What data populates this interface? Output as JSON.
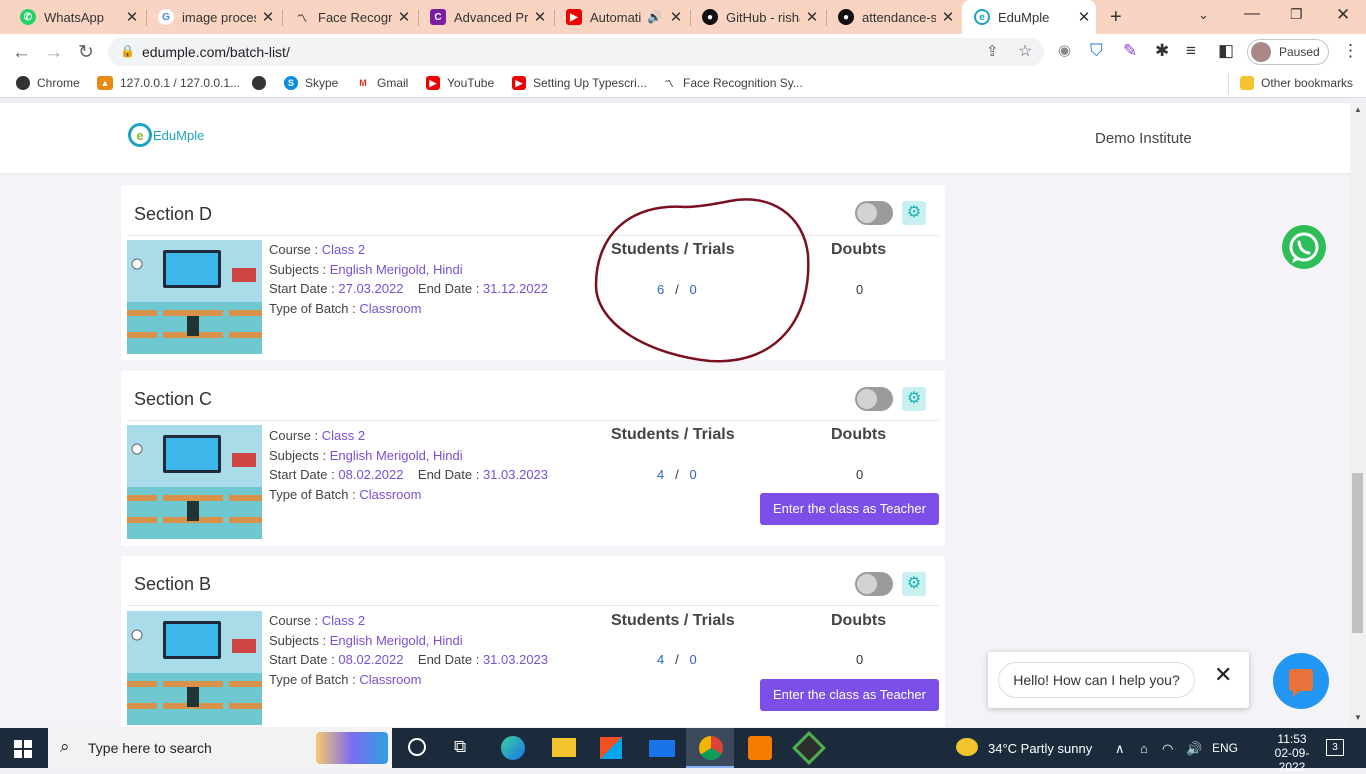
{
  "tabs": [
    {
      "title": "WhatsApp",
      "icon": "whatsapp-icon"
    },
    {
      "title": "image process",
      "icon": "google-icon"
    },
    {
      "title": "Face Recogniti",
      "icon": "chart-icon"
    },
    {
      "title": "Advanced Pro",
      "icon": "cs-icon"
    },
    {
      "title": "Automati",
      "icon": "youtube-icon"
    },
    {
      "title": "GitHub - risha",
      "icon": "github-icon"
    },
    {
      "title": "attendance-sy",
      "icon": "github-icon"
    },
    {
      "title": "EduMple",
      "icon": "edumple-icon"
    }
  ],
  "browser": {
    "url": "edumple.com/batch-list/",
    "profile": "Paused"
  },
  "bookmarks": [
    {
      "label": "Chrome",
      "icon": "chrome-icon"
    },
    {
      "label": "127.0.0.1 / 127.0.0.1...",
      "icon": "pma-icon"
    },
    {
      "label": "",
      "icon": "globe-icon"
    },
    {
      "label": "Skype",
      "icon": "skype-icon"
    },
    {
      "label": "Gmail",
      "icon": "gmail-icon"
    },
    {
      "label": "YouTube",
      "icon": "youtube-icon"
    },
    {
      "label": "Setting Up Typescri...",
      "icon": "youtube-icon"
    },
    {
      "label": "Face Recognition Sy...",
      "icon": "chart-icon"
    }
  ],
  "other_bookmarks": "Other bookmarks",
  "site": {
    "logo": "EduMple",
    "institute": "Demo Institute"
  },
  "labels": {
    "course": "Course : ",
    "subjects": "Subjects : ",
    "start": "Start Date : ",
    "end": "End Date : ",
    "type": "Type of Batch : ",
    "students_trials": "Students / Trials",
    "doubts": "Doubts",
    "slash": "/",
    "teacher_button": "Enter the class as Teacher"
  },
  "batches": [
    {
      "name": "Section D",
      "course": "Class 2",
      "subjects": "English Merigold, Hindi",
      "start": "27.03.2022",
      "end": "31.12.2022",
      "type": "Classroom",
      "students": "6",
      "trials": "0",
      "doubts": "0"
    },
    {
      "name": "Section C",
      "course": "Class 2",
      "subjects": "English Merigold, Hindi",
      "start": "08.02.2022",
      "end": "31.03.2023",
      "type": "Classroom",
      "students": "4",
      "trials": "0",
      "doubts": "0"
    },
    {
      "name": "Section B",
      "course": "Class 2",
      "subjects": "English Merigold, Hindi",
      "start": "08.02.2022",
      "end": "31.03.2023",
      "type": "Classroom",
      "students": "4",
      "trials": "0",
      "doubts": "0"
    }
  ],
  "chat": {
    "prompt": "Hello! How can I help you?"
  },
  "taskbar": {
    "search_placeholder": "Type here to search",
    "weather": "34°C  Partly sunny",
    "language": "ENG",
    "time": "11:53",
    "date": "02-09-2022",
    "notifications": "3"
  },
  "colors": {
    "tab_strip": "#f9d4c2",
    "accent": "#7b4fe8",
    "link": "#7b4fd6",
    "annotation": "#7a0f1f"
  }
}
